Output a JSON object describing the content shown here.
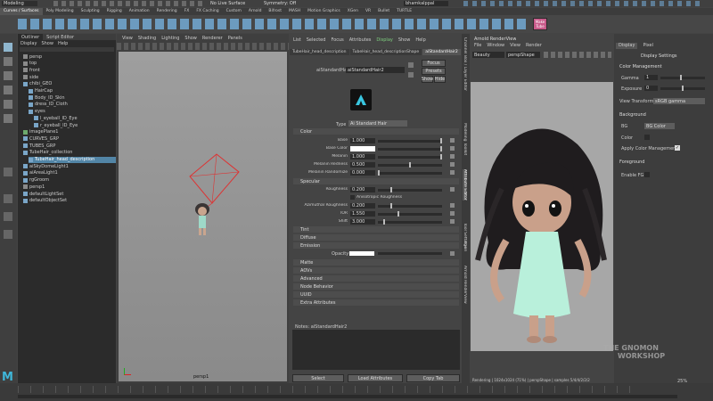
{
  "menu": {
    "workspace": "Modeling",
    "no_live": "No Live Surface",
    "symmetry": "Symmetry: Off",
    "user": "bhamkalppal"
  },
  "shelf": {
    "tabs": [
      "Curves / Surfaces",
      "Poly Modeling",
      "Sculpting",
      "Rigging",
      "Animation",
      "Rendering",
      "FX",
      "FX Caching",
      "Custom",
      "Arnold",
      "Bifrost",
      "MASH",
      "Motion Graphics",
      "XGen",
      "VR",
      "Bullet",
      "TURTLE"
    ],
    "make_tube": "Make Tube"
  },
  "outliner": {
    "tabs": [
      "Outliner",
      "Script Editor"
    ],
    "menu": [
      "Display",
      "Show",
      "Help"
    ],
    "items": [
      "persp",
      "top",
      "front",
      "side",
      "chibi_GEO",
      "HairCap",
      "Body_ID_Skin",
      "dress_ID_Cloth",
      "eyes",
      "l_eyeball_ID_Eye",
      "r_eyeball_ID_Eye",
      "imagePlane1",
      "CURVES_GRP",
      "TUBES_GRP",
      "TubeHair_collection",
      "TubeHair_head_description",
      "aiSkyDomeLight1",
      "aiAreaLight1",
      "rgGroom",
      "persp1",
      "defaultLightSet",
      "defaultObjectSet"
    ]
  },
  "viewport": {
    "menu": [
      "View",
      "Shading",
      "Lighting",
      "Show",
      "Renderer",
      "Panels"
    ],
    "camera": "persp1"
  },
  "attr": {
    "menu": [
      "List",
      "Selected",
      "Focus",
      "Attributes",
      "Display",
      "Show",
      "Help"
    ],
    "tabs": [
      "TubeHair_head_description",
      "TubeHair_head_descriptionShape",
      "aiStandardHair2"
    ],
    "node_label": "aiStandardHair:",
    "node_value": "aiStandardHair2",
    "focus": "Focus",
    "presets": "Presets",
    "show": "Show",
    "hide": "Hide",
    "type_label": "Type",
    "type_value": "Ai Standard Hair",
    "sections": {
      "color": "Color",
      "specular": "Specular",
      "tint": "Tint",
      "diffuse": "Diffuse",
      "emission": "Emission",
      "matte": "Matte",
      "aovs": "AOVs",
      "advanced": "Advanced",
      "node_behavior": "Node Behavior",
      "uuid": "UUID",
      "extra": "Extra Attributes"
    },
    "color_rows": [
      {
        "label": "Base",
        "value": "1.000"
      },
      {
        "label": "Base Color",
        "value": ""
      },
      {
        "label": "Melanin",
        "value": "1.000"
      },
      {
        "label": "Melanin Redness",
        "value": "0.500"
      },
      {
        "label": "Melanin Randomize",
        "value": "0.000"
      }
    ],
    "spec_rows": [
      {
        "label": "Roughness",
        "value": "0.200"
      },
      {
        "label": "Anisotropic Roughness",
        "value": ""
      },
      {
        "label": "Azimuthal Roughness",
        "value": "0.200"
      },
      {
        "label": "IOR",
        "value": "1.550"
      },
      {
        "label": "Shift",
        "value": "3.000"
      }
    ],
    "opacity": "Opacity",
    "notes": "Notes: aiStandardHair2",
    "buttons": [
      "Select",
      "Load Attributes",
      "Copy Tab"
    ]
  },
  "side_tabs": [
    "Channel Box / Layer Editor",
    "Modeling Toolkit",
    "Attribute Editor",
    "Tool Settings",
    "XGen",
    "Arnold RenderView"
  ],
  "render": {
    "title": "Arnold RenderView",
    "menu": [
      "File",
      "Window",
      "View",
      "Render"
    ],
    "aov": "Beauty",
    "camera": "perspShape",
    "status": "Rendering | 1024x1024 (71%) | perspShape | samples 5/4/4/2/2/2"
  },
  "display": {
    "tabs": [
      "Display",
      "Pixel"
    ],
    "heading": "Display Settings",
    "color_mgmt": "Color Management",
    "gamma": "Gamma",
    "gamma_val": "1",
    "exposure": "Exposure",
    "exposure_val": "0",
    "view_transform": "View Transform",
    "vt_value": "sRGB gamma",
    "background": "Background",
    "bg": "BG",
    "bg_value": "BG Color",
    "color": "Color",
    "apply_cm": "Apply Color Management",
    "foreground": "Foreground",
    "enable_fg": "Enable FG"
  },
  "watermark": {
    "line1": "THE GNOMON",
    "line2": "WORKSHOP"
  },
  "zoom": "25%",
  "colors": {
    "selected": "#5285a6",
    "accent": "#8fb6ce"
  }
}
